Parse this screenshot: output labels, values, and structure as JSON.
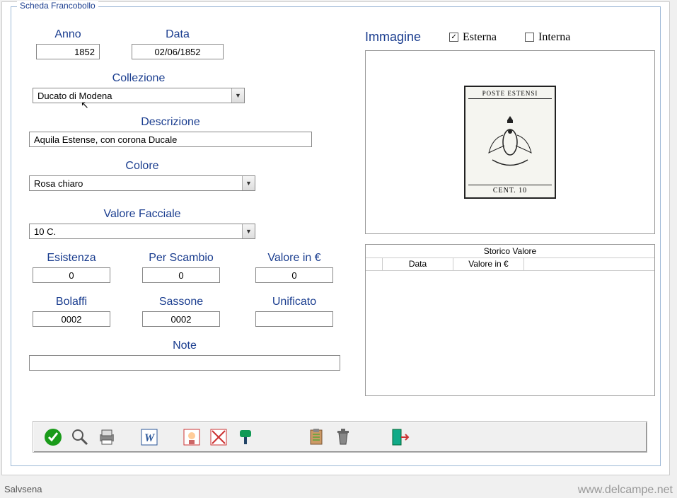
{
  "legend": "Scheda Francobollo",
  "labels": {
    "anno": "Anno",
    "data": "Data",
    "collezione": "Collezione",
    "descrizione": "Descrizione",
    "colore": "Colore",
    "valore_facciale": "Valore Facciale",
    "esistenza": "Esistenza",
    "per_scambio": "Per Scambio",
    "valore_eur": "Valore in €",
    "bolaffi": "Bolaffi",
    "sassone": "Sassone",
    "unificato": "Unificato",
    "note": "Note",
    "immagine": "Immagine",
    "esterna": "Esterna",
    "interna": "Interna"
  },
  "values": {
    "anno": "1852",
    "data": "02/06/1852",
    "collezione": "Ducato di Modena",
    "descrizione": "Aquila Estense, con corona Ducale",
    "colore": "Rosa chiaro",
    "valore_facciale": "10 C.",
    "esistenza": "0",
    "per_scambio": "0",
    "valore_eur": "0",
    "bolaffi": "0002",
    "sassone": "0002",
    "unificato": "",
    "note": ""
  },
  "checkboxes": {
    "esterna": true,
    "interna": false
  },
  "stamp": {
    "top": "POSTE ESTENSI",
    "bottom": "CENT. 10"
  },
  "history": {
    "title": "Storico Valore",
    "columns": [
      "Data",
      "Valore in €"
    ]
  },
  "status": {
    "left": "Salvsena",
    "right": "www.delcampe.net"
  }
}
